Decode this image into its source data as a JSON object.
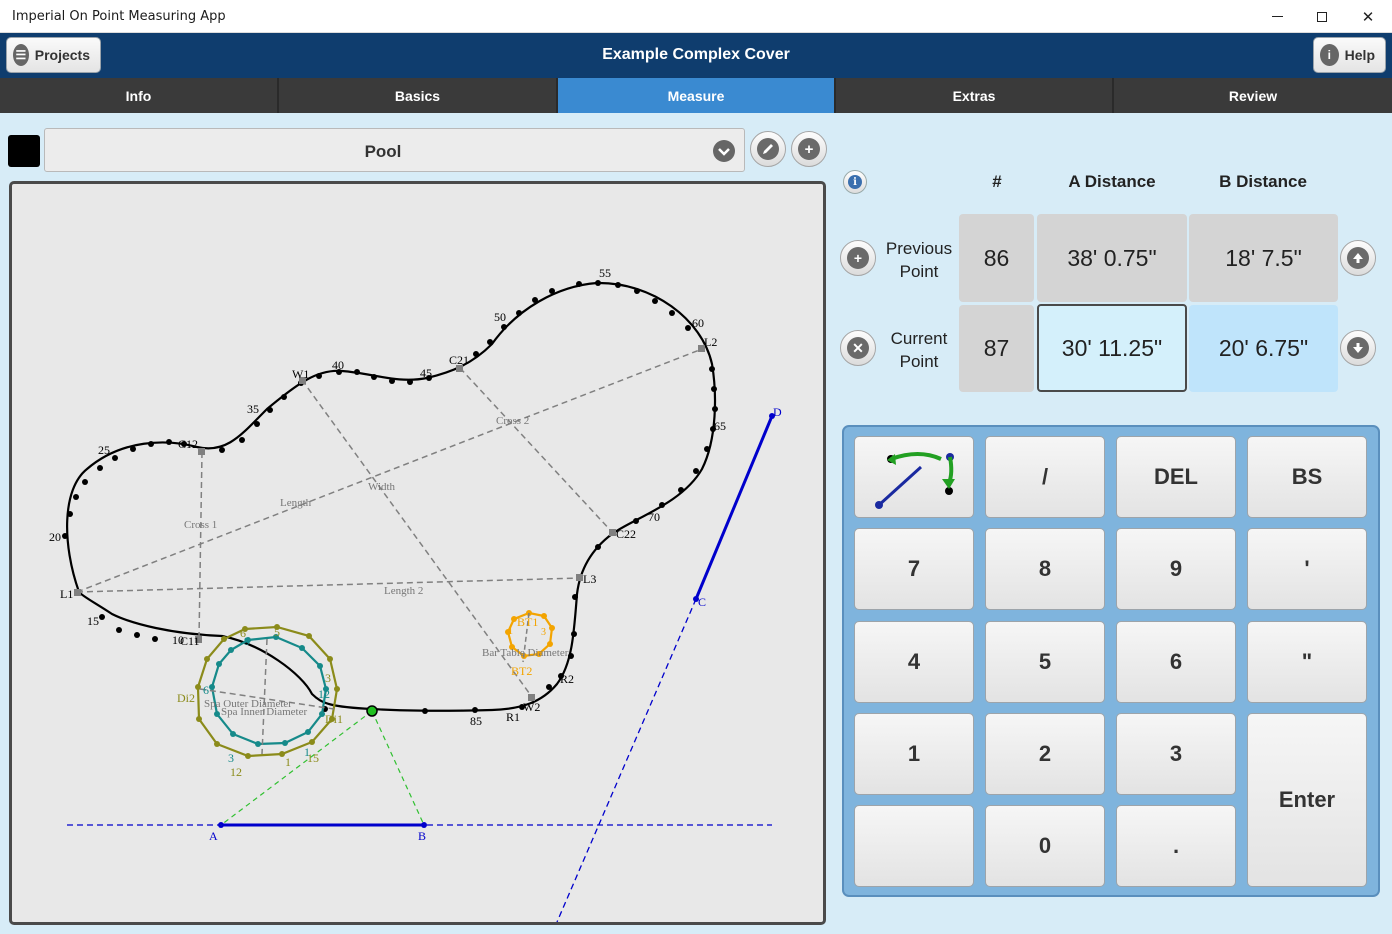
{
  "window": {
    "title": "Imperial On Point Measuring App"
  },
  "header": {
    "title": "Example Complex Cover",
    "projects_label": "Projects",
    "help_label": "Help"
  },
  "tabs": [
    "Info",
    "Basics",
    "Measure",
    "Extras",
    "Review"
  ],
  "active_tab": "Measure",
  "shape_selector": {
    "value": "Pool",
    "color": "#000000"
  },
  "table": {
    "headers": {
      "num": "#",
      "a": "A Distance",
      "b": "B Distance"
    },
    "previous": {
      "label_line1": "Previous",
      "label_line2": "Point",
      "num": "86",
      "a": "38' 0.75\"",
      "b": "18' 7.5\""
    },
    "current": {
      "label_line1": "Current",
      "label_line2": "Point",
      "num": "87",
      "a": "30' 11.25\"",
      "b": "20' 6.75\""
    }
  },
  "keypad": {
    "keys": [
      "/",
      "DEL",
      "BS",
      "7",
      "8",
      "9",
      "'",
      "4",
      "5",
      "6",
      "\"",
      "1",
      "2",
      "3",
      "Enter",
      "0",
      "."
    ]
  },
  "icons": {
    "projects": "list-icon",
    "help": "info-icon",
    "edit": "pencil-icon",
    "add": "plus-icon",
    "add_point": "plus-icon",
    "delete_point": "x-icon",
    "move_up": "arrow-up-icon",
    "move_down": "arrow-down-icon",
    "swap": "swap-points-icon"
  },
  "colors": {
    "header": "#0f3d6e",
    "active_tab": "#3a8ad1",
    "keypad": "#7fb4dd",
    "pool_outline": "#000000",
    "spa_outer": "#8b8b1a",
    "spa_inner": "#168a8a",
    "bar_table": "#f3a400",
    "reference": "#0000cc"
  },
  "canvas_labels": {
    "pool_points": [
      "55",
      "50",
      "60",
      "L2",
      "C21",
      "45",
      "40",
      "W1",
      "35",
      "C12",
      "25",
      "20",
      "L1",
      "15",
      "10",
      "C11",
      "65",
      "70",
      "C22",
      "L3",
      "R2",
      "W2",
      "R1",
      "85"
    ],
    "pool_dims": [
      "Cross 2",
      "Width",
      "Length",
      "Cross 1",
      "Length 2",
      "Bar Table Diameter"
    ],
    "spa_labels": [
      "Di2",
      "Spa Outer Diameter",
      "Spa Inner Diameter",
      "Di1",
      "6",
      "5",
      "3",
      "12",
      "1",
      "15",
      "9",
      "3",
      "12",
      "6",
      "1"
    ],
    "bar_labels": [
      "BT1",
      "BT2",
      "1",
      "3"
    ],
    "reference_points": [
      "A",
      "B",
      "C",
      "D"
    ]
  }
}
